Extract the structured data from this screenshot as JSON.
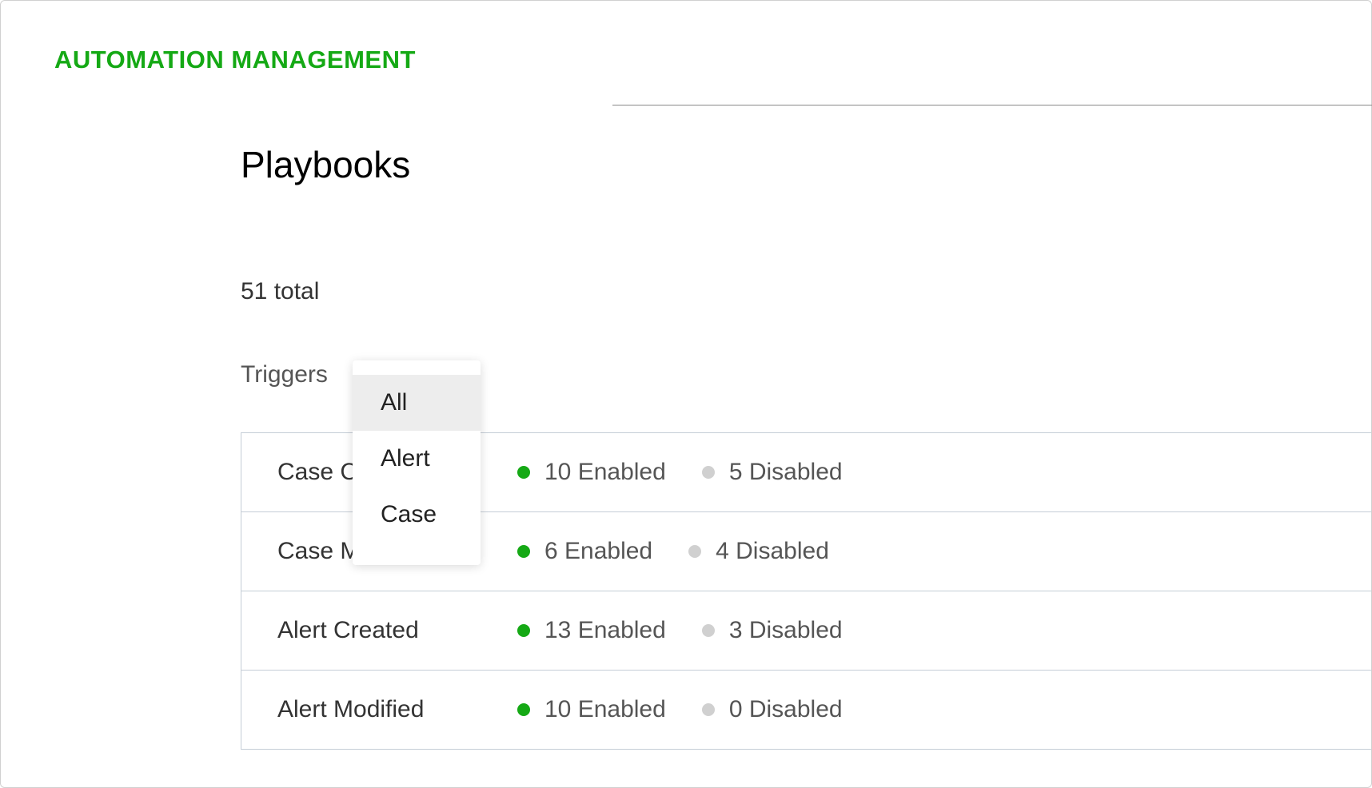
{
  "header": {
    "title": "AUTOMATION MANAGEMENT"
  },
  "page": {
    "title": "Playbooks",
    "total": "51 total",
    "triggers_label": "Triggers"
  },
  "dropdown": {
    "items": [
      {
        "label": "All",
        "selected": true
      },
      {
        "label": "Alert",
        "selected": false
      },
      {
        "label": "Case",
        "selected": false
      }
    ]
  },
  "rows": [
    {
      "name": "Case Created",
      "enabled": "10 Enabled",
      "disabled": "5 Disabled"
    },
    {
      "name": "Case Modified",
      "enabled": "6 Enabled",
      "disabled": "4 Disabled"
    },
    {
      "name": "Alert Created",
      "enabled": "13 Enabled",
      "disabled": "3 Disabled"
    },
    {
      "name": "Alert Modified",
      "enabled": "10 Enabled",
      "disabled": "0 Disabled"
    }
  ]
}
